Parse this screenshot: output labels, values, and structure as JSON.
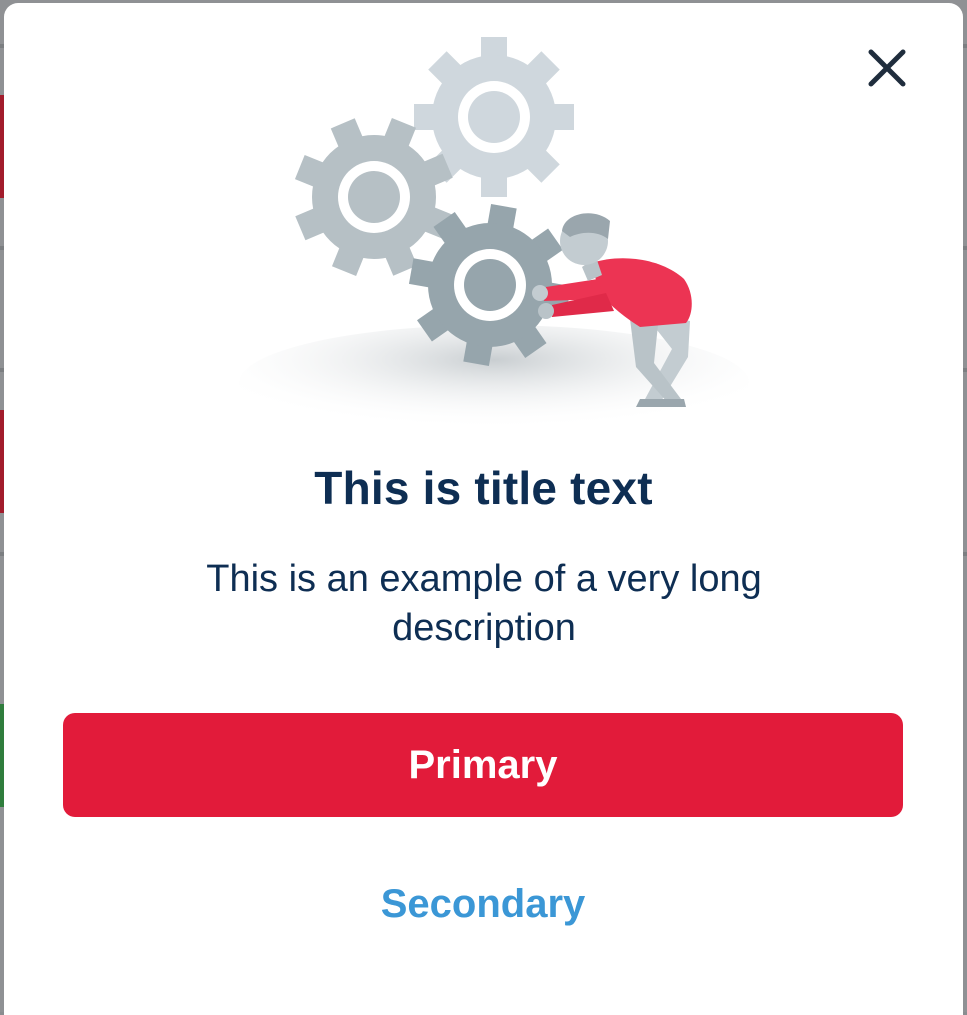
{
  "dialog": {
    "close_icon": "close-icon",
    "illustration": "gears-person-illustration",
    "title": "This is title text",
    "description": "This is an example of a very long description",
    "primary_label": "Primary",
    "secondary_label": "Secondary"
  },
  "colors": {
    "primary": "#e21b3a",
    "secondary_text": "#3b97d6",
    "heading_text": "#0e2e53",
    "overlay": "#8f9194"
  }
}
